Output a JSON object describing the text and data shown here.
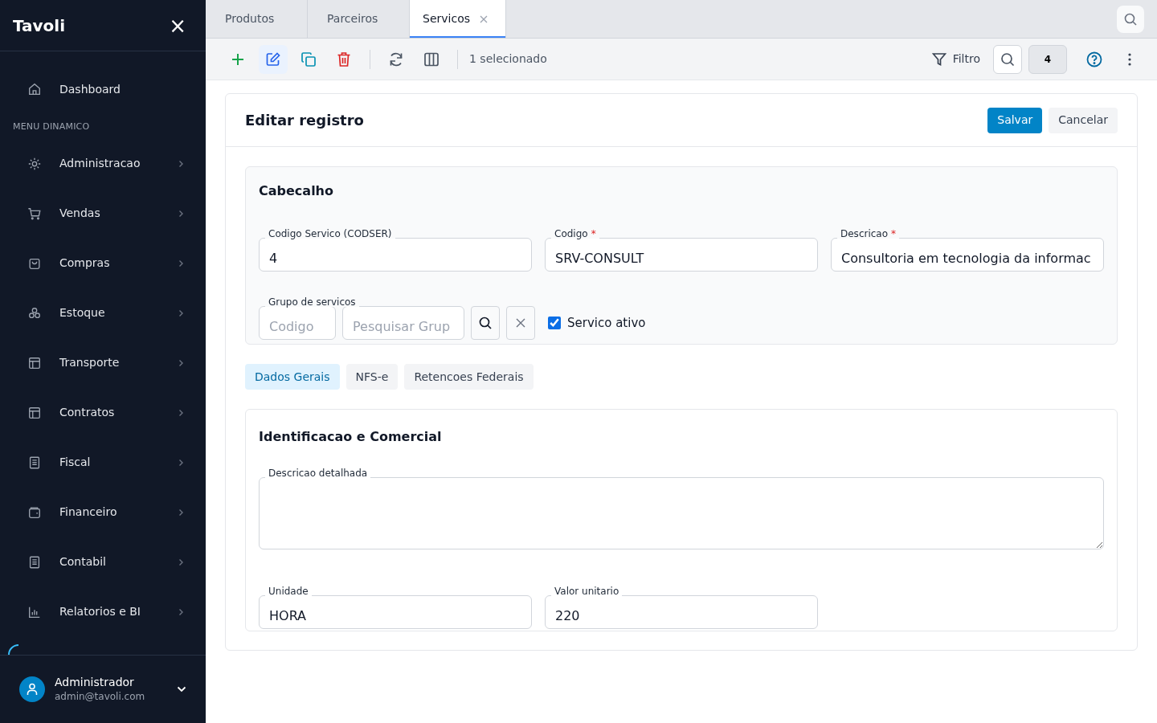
{
  "sidebar": {
    "brand": "Tavoli",
    "close_icon": "×",
    "top_items": [
      {
        "label": "Dashboard"
      }
    ],
    "section_title": "MENU DINAMICO",
    "items": [
      {
        "label": "Administracao",
        "expanded": false
      },
      {
        "label": "Vendas",
        "expanded": false
      },
      {
        "label": "Compras",
        "expanded": false
      },
      {
        "label": "Estoque",
        "expanded": false
      },
      {
        "label": "Transporte",
        "expanded": false
      },
      {
        "label": "Contratos",
        "expanded": false
      },
      {
        "label": "Fiscal",
        "expanded": false
      },
      {
        "label": "Financeiro",
        "expanded": false
      },
      {
        "label": "Contabil",
        "expanded": false
      },
      {
        "label": "Relatorios e BI",
        "expanded": false
      }
    ],
    "user": {
      "name": "Administrador",
      "email": "admin@tavoli.com"
    }
  },
  "tabs": [
    {
      "label": "Produtos",
      "selected": false,
      "closable": false
    },
    {
      "label": "Parceiros",
      "selected": false,
      "closable": false
    },
    {
      "label": "Servicos",
      "selected": true,
      "closable": true
    }
  ],
  "toolbar": {
    "selection": "1 selecionado",
    "filter": "Filtro",
    "count": "4"
  },
  "form": {
    "title": "Editar registro",
    "save": "Salvar",
    "cancel": "Cancelar",
    "header": {
      "title": "Cabecalho",
      "fields": [
        {
          "label": "Codigo Servico (CODSER)",
          "value": "4"
        },
        {
          "label": "Codigo",
          "required_mark": "*",
          "value": "SRV-CONSULT"
        },
        {
          "label": "Descricao",
          "required_mark": "*",
          "value": "Consultoria em tecnologia da informac"
        }
      ],
      "group": {
        "label": "Grupo de servicos",
        "code_placeholder": "Codigo",
        "search_placeholder": "Pesquisar Grup"
      },
      "active": {
        "label": "Servico ativo",
        "checked": true
      }
    },
    "subtabs": [
      {
        "label": "Dados Gerais",
        "selected": true
      },
      {
        "label": "NFS-e",
        "selected": false
      },
      {
        "label": "Retencoes Federais",
        "selected": false
      }
    ],
    "section": {
      "title": "Identificacao e Comercial",
      "description_label": "Descricao detalhada",
      "fields": [
        {
          "label": "Unidade",
          "value": "HORA"
        },
        {
          "label": "Valor unitario",
          "value": "220"
        }
      ]
    }
  }
}
